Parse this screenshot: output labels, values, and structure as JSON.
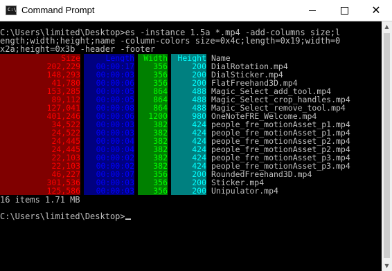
{
  "window": {
    "title": "Command Prompt",
    "icon_label": "C:\\",
    "buttons": {
      "minimize": "—",
      "maximize": "□",
      "close": "✕"
    }
  },
  "console": {
    "command_lines": [
      "C:\\Users\\limited\\Desktop>es -instance 1.5a *.mp4 -add-columns size;l",
      "ength;width;height;name -column-colors size=0x4c;length=0x19;width=0",
      "x2a;height=0x3b -header -footer"
    ],
    "header": {
      "size": "Size",
      "length": "Length",
      "width": "Width",
      "height": "Height",
      "name": "Name"
    },
    "rows": [
      {
        "size": "202,229",
        "length": "00:00:17",
        "width": "356",
        "height": "200",
        "name": "DialRotation.mp4"
      },
      {
        "size": "148,293",
        "length": "00:00:03",
        "width": "356",
        "height": "200",
        "name": "DialSticker.mp4"
      },
      {
        "size": "41,780",
        "length": "00:00:06",
        "width": "356",
        "height": "200",
        "name": "FlatFreehand3D.mp4"
      },
      {
        "size": "153,285",
        "length": "00:00:05",
        "width": "864",
        "height": "488",
        "name": "Magic_Select_add_tool.mp4"
      },
      {
        "size": "89,112",
        "length": "00:00:05",
        "width": "864",
        "height": "488",
        "name": "Magic_Select_crop_handles.mp4"
      },
      {
        "size": "127,041",
        "length": "00:00:08",
        "width": "864",
        "height": "488",
        "name": "Magic_Select_remove_tool.mp4"
      },
      {
        "size": "401,246",
        "length": "00:00:06",
        "width": "1200",
        "height": "980",
        "name": "OneNoteFRE_Welcome.mp4"
      },
      {
        "size": "34,522",
        "length": "00:00:03",
        "width": "382",
        "height": "424",
        "name": "people_fre_motionAsset_p1.mp4"
      },
      {
        "size": "24,522",
        "length": "00:00:03",
        "width": "382",
        "height": "424",
        "name": "people_fre_motionAsset_p1.mp4"
      },
      {
        "size": "24,445",
        "length": "00:00:04",
        "width": "382",
        "height": "424",
        "name": "people_fre_motionAsset_p2.mp4"
      },
      {
        "size": "24,445",
        "length": "00:00:04",
        "width": "382",
        "height": "424",
        "name": "people_fre_motionAsset_p2.mp4"
      },
      {
        "size": "22,103",
        "length": "00:00:02",
        "width": "382",
        "height": "424",
        "name": "people_fre_motionAsset_p3.mp4"
      },
      {
        "size": "22,103",
        "length": "00:00:02",
        "width": "382",
        "height": "424",
        "name": "people_fre_motionAsset_p3.mp4"
      },
      {
        "size": "46,227",
        "length": "00:00:07",
        "width": "356",
        "height": "200",
        "name": "RoundedFreehand3D.mp4"
      },
      {
        "size": "301,536",
        "length": "00:00:03",
        "width": "356",
        "height": "200",
        "name": "Sticker.mp4"
      },
      {
        "size": "125,586",
        "length": "00:00:03",
        "width": "356",
        "height": "200",
        "name": "Unipulator.mp4"
      }
    ],
    "footer": "16 items 1.71 MB",
    "prompt": "C:\\Users\\limited\\Desktop>",
    "colors": {
      "size_bg": "#800000",
      "size_fg": "#ff0000",
      "length_bg": "#000080",
      "length_fg": "#0000ff",
      "width_bg": "#008000",
      "width_fg": "#00ff00",
      "height_bg": "#008080",
      "height_fg": "#00ffff",
      "text": "#c0c0c0",
      "background": "#000000"
    }
  },
  "scrollbar": {
    "up_icon": "arrow-up",
    "down_icon": "arrow-down"
  }
}
